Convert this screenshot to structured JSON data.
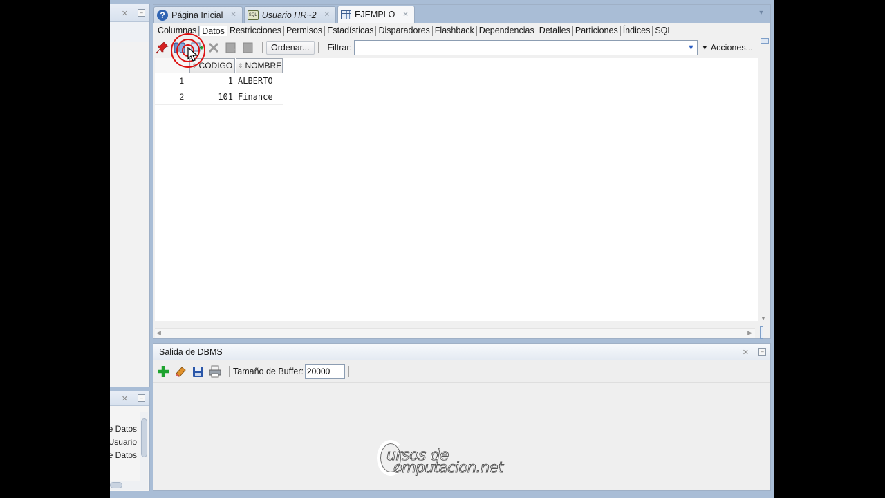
{
  "document_tabs": [
    {
      "label": "Página Inicial",
      "icon": "help-icon",
      "italic": false,
      "active": false
    },
    {
      "label": "Usuario HR~2",
      "icon": "sql-worksheet-icon",
      "italic": true,
      "active": false
    },
    {
      "label": "EJEMPLO",
      "icon": "table-icon",
      "italic": false,
      "active": true
    }
  ],
  "sub_tabs": [
    "Columnas",
    "Datos",
    "Restricciones",
    "Permisos",
    "Estadísticas",
    "Disparadores",
    "Flashback",
    "Dependencias",
    "Detalles",
    "Particiones",
    "Índices",
    "SQL"
  ],
  "active_sub_tab": "Datos",
  "toolbar": {
    "ordenar_label": "Ordenar...",
    "filter_label": "Filtrar:",
    "filter_value": "",
    "acciones_label": "Acciones..."
  },
  "grid": {
    "columns": [
      "CODIGO",
      "NOMBRE"
    ],
    "rows": [
      {
        "num": "1",
        "codigo": "1",
        "nombre": "ALBERTO"
      },
      {
        "num": "2",
        "codigo": "101",
        "nombre": "Finance"
      }
    ]
  },
  "dbms": {
    "title": "Salida de DBMS",
    "buffer_label": "Tamaño de Buffer:",
    "buffer_value": "20000"
  },
  "left_panel_items": [
    "e Datos",
    "Usuario",
    "e Datos"
  ],
  "watermark": {
    "line1": "ursos de",
    "line2": "omputacion.net"
  },
  "colors": {
    "frame": "#a9bdd6",
    "accent_red": "#d11111",
    "link_blue": "#2b5ec4"
  }
}
